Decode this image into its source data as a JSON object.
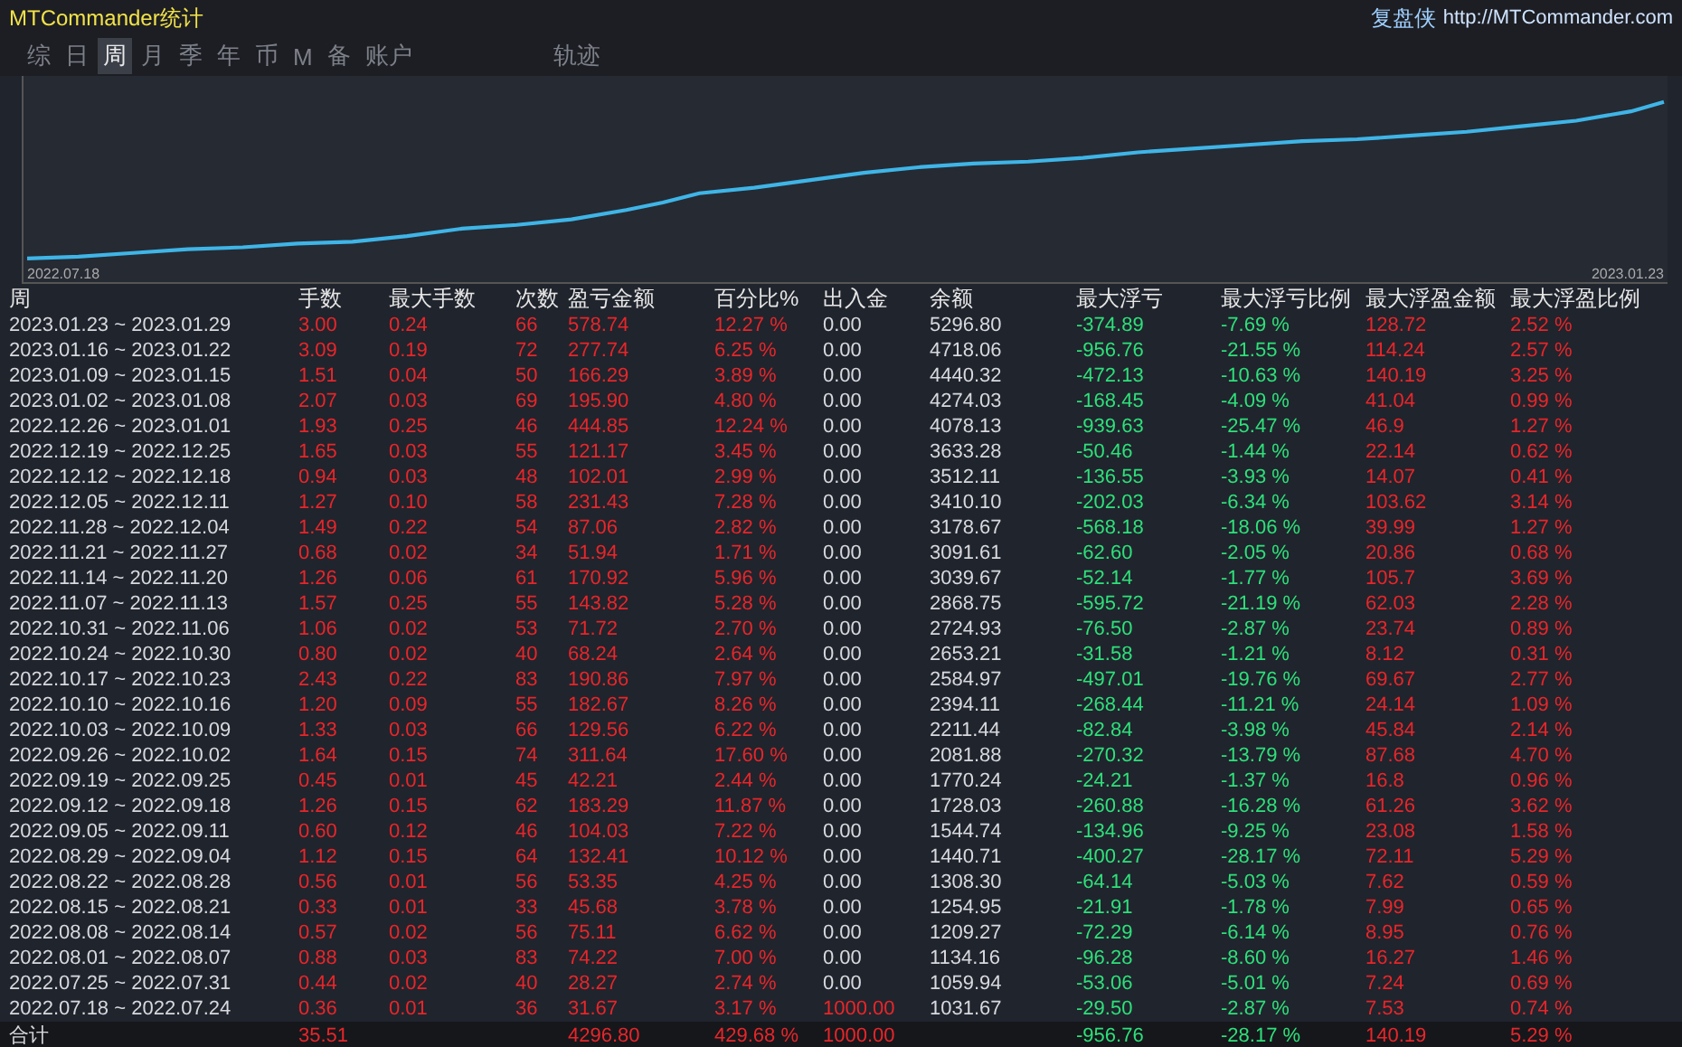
{
  "window": {
    "title": "MTCommander统计",
    "brand": "复盘侠",
    "url": "http://MTCommander.com"
  },
  "tabs": [
    {
      "label": "综",
      "selected": false
    },
    {
      "label": "日",
      "selected": false
    },
    {
      "label": "周",
      "selected": true
    },
    {
      "label": "月",
      "selected": false
    },
    {
      "label": "季",
      "selected": false
    },
    {
      "label": "年",
      "selected": false
    },
    {
      "label": "币",
      "selected": false
    },
    {
      "label": "M",
      "selected": false
    },
    {
      "label": "备",
      "selected": false
    },
    {
      "label": "账户",
      "selected": false
    },
    {
      "label": "轨迹",
      "selected": false
    }
  ],
  "chart": {
    "start_label": "2022.07.18",
    "end_label": "2023.01.23"
  },
  "table": {
    "columns": [
      {
        "label": "周",
        "kind": "plain"
      },
      {
        "label": "手数",
        "kind": "red"
      },
      {
        "label": "最大手数",
        "kind": "red"
      },
      {
        "label": "次数",
        "kind": "red"
      },
      {
        "label": "盈亏金额",
        "kind": "red"
      },
      {
        "label": "百分比%",
        "kind": "red"
      },
      {
        "label": "出入金",
        "kind": "cash"
      },
      {
        "label": "余额",
        "kind": "plain"
      },
      {
        "label": "最大浮亏",
        "kind": "green"
      },
      {
        "label": "最大浮亏比例",
        "kind": "green"
      },
      {
        "label": "最大浮盈金额",
        "kind": "red"
      },
      {
        "label": "最大浮盈比例",
        "kind": "red"
      }
    ],
    "rows": [
      {
        "deposit": false,
        "cells": [
          "2023.01.23 ~ 2023.01.29",
          "3.00",
          "0.24",
          "66",
          "578.74",
          "12.27 %",
          "0.00",
          "5296.80",
          "-374.89",
          "-7.69 %",
          "128.72",
          "2.52 %"
        ]
      },
      {
        "deposit": false,
        "cells": [
          "2023.01.16 ~ 2023.01.22",
          "3.09",
          "0.19",
          "72",
          "277.74",
          "6.25 %",
          "0.00",
          "4718.06",
          "-956.76",
          "-21.55 %",
          "114.24",
          "2.57 %"
        ]
      },
      {
        "deposit": false,
        "cells": [
          "2023.01.09 ~ 2023.01.15",
          "1.51",
          "0.04",
          "50",
          "166.29",
          "3.89 %",
          "0.00",
          "4440.32",
          "-472.13",
          "-10.63 %",
          "140.19",
          "3.25 %"
        ]
      },
      {
        "deposit": false,
        "cells": [
          "2023.01.02 ~ 2023.01.08",
          "2.07",
          "0.03",
          "69",
          "195.90",
          "4.80 %",
          "0.00",
          "4274.03",
          "-168.45",
          "-4.09 %",
          "41.04",
          "0.99 %"
        ]
      },
      {
        "deposit": false,
        "cells": [
          "2022.12.26 ~ 2023.01.01",
          "1.93",
          "0.25",
          "46",
          "444.85",
          "12.24 %",
          "0.00",
          "4078.13",
          "-939.63",
          "-25.47 %",
          "46.9",
          "1.27 %"
        ]
      },
      {
        "deposit": false,
        "cells": [
          "2022.12.19 ~ 2022.12.25",
          "1.65",
          "0.03",
          "55",
          "121.17",
          "3.45 %",
          "0.00",
          "3633.28",
          "-50.46",
          "-1.44 %",
          "22.14",
          "0.62 %"
        ]
      },
      {
        "deposit": false,
        "cells": [
          "2022.12.12 ~ 2022.12.18",
          "0.94",
          "0.03",
          "48",
          "102.01",
          "2.99 %",
          "0.00",
          "3512.11",
          "-136.55",
          "-3.93 %",
          "14.07",
          "0.41 %"
        ]
      },
      {
        "deposit": false,
        "cells": [
          "2022.12.05 ~ 2022.12.11",
          "1.27",
          "0.10",
          "58",
          "231.43",
          "7.28 %",
          "0.00",
          "3410.10",
          "-202.03",
          "-6.34 %",
          "103.62",
          "3.14 %"
        ]
      },
      {
        "deposit": false,
        "cells": [
          "2022.11.28 ~ 2022.12.04",
          "1.49",
          "0.22",
          "54",
          "87.06",
          "2.82 %",
          "0.00",
          "3178.67",
          "-568.18",
          "-18.06 %",
          "39.99",
          "1.27 %"
        ]
      },
      {
        "deposit": false,
        "cells": [
          "2022.11.21 ~ 2022.11.27",
          "0.68",
          "0.02",
          "34",
          "51.94",
          "1.71 %",
          "0.00",
          "3091.61",
          "-62.60",
          "-2.05 %",
          "20.86",
          "0.68 %"
        ]
      },
      {
        "deposit": false,
        "cells": [
          "2022.11.14 ~ 2022.11.20",
          "1.26",
          "0.06",
          "61",
          "170.92",
          "5.96 %",
          "0.00",
          "3039.67",
          "-52.14",
          "-1.77 %",
          "105.7",
          "3.69 %"
        ]
      },
      {
        "deposit": false,
        "cells": [
          "2022.11.07 ~ 2022.11.13",
          "1.57",
          "0.25",
          "55",
          "143.82",
          "5.28 %",
          "0.00",
          "2868.75",
          "-595.72",
          "-21.19 %",
          "62.03",
          "2.28 %"
        ]
      },
      {
        "deposit": false,
        "cells": [
          "2022.10.31 ~ 2022.11.06",
          "1.06",
          "0.02",
          "53",
          "71.72",
          "2.70 %",
          "0.00",
          "2724.93",
          "-76.50",
          "-2.87 %",
          "23.74",
          "0.89 %"
        ]
      },
      {
        "deposit": false,
        "cells": [
          "2022.10.24 ~ 2022.10.30",
          "0.80",
          "0.02",
          "40",
          "68.24",
          "2.64 %",
          "0.00",
          "2653.21",
          "-31.58",
          "-1.21 %",
          "8.12",
          "0.31 %"
        ]
      },
      {
        "deposit": false,
        "cells": [
          "2022.10.17 ~ 2022.10.23",
          "2.43",
          "0.22",
          "83",
          "190.86",
          "7.97 %",
          "0.00",
          "2584.97",
          "-497.01",
          "-19.76 %",
          "69.67",
          "2.77 %"
        ]
      },
      {
        "deposit": false,
        "cells": [
          "2022.10.10 ~ 2022.10.16",
          "1.20",
          "0.09",
          "55",
          "182.67",
          "8.26 %",
          "0.00",
          "2394.11",
          "-268.44",
          "-11.21 %",
          "24.14",
          "1.09 %"
        ]
      },
      {
        "deposit": false,
        "cells": [
          "2022.10.03 ~ 2022.10.09",
          "1.33",
          "0.03",
          "66",
          "129.56",
          "6.22 %",
          "0.00",
          "2211.44",
          "-82.84",
          "-3.98 %",
          "45.84",
          "2.14 %"
        ]
      },
      {
        "deposit": false,
        "cells": [
          "2022.09.26 ~ 2022.10.02",
          "1.64",
          "0.15",
          "74",
          "311.64",
          "17.60 %",
          "0.00",
          "2081.88",
          "-270.32",
          "-13.79 %",
          "87.68",
          "4.70 %"
        ]
      },
      {
        "deposit": false,
        "cells": [
          "2022.09.19 ~ 2022.09.25",
          "0.45",
          "0.01",
          "45",
          "42.21",
          "2.44 %",
          "0.00",
          "1770.24",
          "-24.21",
          "-1.37 %",
          "16.8",
          "0.96 %"
        ]
      },
      {
        "deposit": false,
        "cells": [
          "2022.09.12 ~ 2022.09.18",
          "1.26",
          "0.15",
          "62",
          "183.29",
          "11.87 %",
          "0.00",
          "1728.03",
          "-260.88",
          "-16.28 %",
          "61.26",
          "3.62 %"
        ]
      },
      {
        "deposit": false,
        "cells": [
          "2022.09.05 ~ 2022.09.11",
          "0.60",
          "0.12",
          "46",
          "104.03",
          "7.22 %",
          "0.00",
          "1544.74",
          "-134.96",
          "-9.25 %",
          "23.08",
          "1.58 %"
        ]
      },
      {
        "deposit": false,
        "cells": [
          "2022.08.29 ~ 2022.09.04",
          "1.12",
          "0.15",
          "64",
          "132.41",
          "10.12 %",
          "0.00",
          "1440.71",
          "-400.27",
          "-28.17 %",
          "72.11",
          "5.29 %"
        ]
      },
      {
        "deposit": false,
        "cells": [
          "2022.08.22 ~ 2022.08.28",
          "0.56",
          "0.01",
          "56",
          "53.35",
          "4.25 %",
          "0.00",
          "1308.30",
          "-64.14",
          "-5.03 %",
          "7.62",
          "0.59 %"
        ]
      },
      {
        "deposit": false,
        "cells": [
          "2022.08.15 ~ 2022.08.21",
          "0.33",
          "0.01",
          "33",
          "45.68",
          "3.78 %",
          "0.00",
          "1254.95",
          "-21.91",
          "-1.78 %",
          "7.99",
          "0.65 %"
        ]
      },
      {
        "deposit": false,
        "cells": [
          "2022.08.08 ~ 2022.08.14",
          "0.57",
          "0.02",
          "56",
          "75.11",
          "6.62 %",
          "0.00",
          "1209.27",
          "-72.29",
          "-6.14 %",
          "8.95",
          "0.76 %"
        ]
      },
      {
        "deposit": false,
        "cells": [
          "2022.08.01 ~ 2022.08.07",
          "0.88",
          "0.03",
          "83",
          "74.22",
          "7.00 %",
          "0.00",
          "1134.16",
          "-96.28",
          "-8.60 %",
          "16.27",
          "1.46 %"
        ]
      },
      {
        "deposit": false,
        "cells": [
          "2022.07.25 ~ 2022.07.31",
          "0.44",
          "0.02",
          "40",
          "28.27",
          "2.74 %",
          "0.00",
          "1059.94",
          "-53.06",
          "-5.01 %",
          "7.24",
          "0.69 %"
        ]
      },
      {
        "deposit": true,
        "cells": [
          "2022.07.18 ~ 2022.07.24",
          "0.36",
          "0.01",
          "36",
          "31.67",
          "3.17 %",
          "1000.00",
          "1031.67",
          "-29.50",
          "-2.87 %",
          "7.53",
          "0.74 %"
        ]
      }
    ],
    "total": {
      "deposit": true,
      "cells": [
        "合计",
        "35.51",
        null,
        null,
        "4296.80",
        "429.68 %",
        "1000.00",
        null,
        "-956.76",
        "-28.17 %",
        "140.19",
        "5.29 %"
      ]
    }
  }
}
